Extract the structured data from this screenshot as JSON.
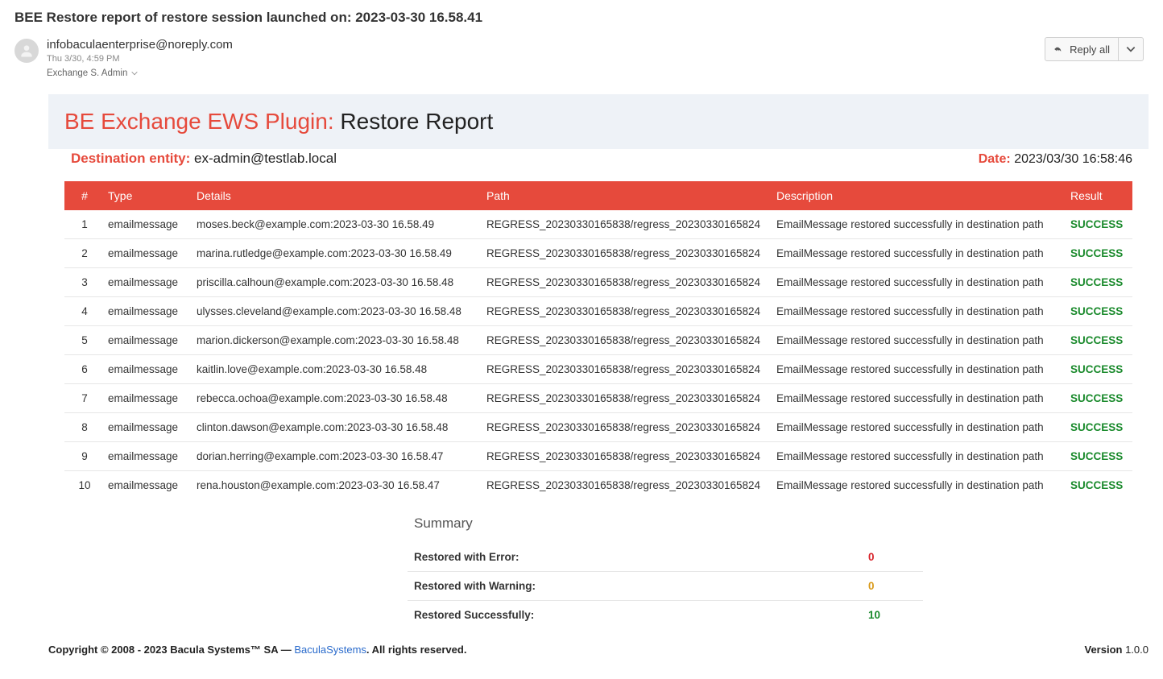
{
  "mail": {
    "subject": "BEE Restore report of restore session launched on: 2023-03-30 16.58.41",
    "sender_email": "infobaculaenterprise@noreply.com",
    "sent_time": "Thu 3/30, 4:59 PM",
    "recipient": "Exchange S. Admin",
    "reply_label": "Reply all"
  },
  "report": {
    "title_prefix": "BE Exchange EWS Plugin:",
    "title_main": "Restore Report",
    "dest_label": "Destination entity:",
    "dest_value": "ex-admin@testlab.local",
    "date_label": "Date:",
    "date_value": "2023/03/30 16:58:46"
  },
  "table": {
    "headers": {
      "num": "#",
      "type": "Type",
      "details": "Details",
      "path": "Path",
      "description": "Description",
      "result": "Result"
    },
    "rows": [
      {
        "num": "1",
        "type": "emailmessage",
        "details": "moses.beck@example.com:2023-03-30 16.58.49",
        "path": "REGRESS_20230330165838/regress_20230330165824",
        "description": "EmailMessage restored successfully in destination path",
        "result": "SUCCESS"
      },
      {
        "num": "2",
        "type": "emailmessage",
        "details": "marina.rutledge@example.com:2023-03-30 16.58.49",
        "path": "REGRESS_20230330165838/regress_20230330165824",
        "description": "EmailMessage restored successfully in destination path",
        "result": "SUCCESS"
      },
      {
        "num": "3",
        "type": "emailmessage",
        "details": "priscilla.calhoun@example.com:2023-03-30 16.58.48",
        "path": "REGRESS_20230330165838/regress_20230330165824",
        "description": "EmailMessage restored successfully in destination path",
        "result": "SUCCESS"
      },
      {
        "num": "4",
        "type": "emailmessage",
        "details": "ulysses.cleveland@example.com:2023-03-30 16.58.48",
        "path": "REGRESS_20230330165838/regress_20230330165824",
        "description": "EmailMessage restored successfully in destination path",
        "result": "SUCCESS"
      },
      {
        "num": "5",
        "type": "emailmessage",
        "details": "marion.dickerson@example.com:2023-03-30 16.58.48",
        "path": "REGRESS_20230330165838/regress_20230330165824",
        "description": "EmailMessage restored successfully in destination path",
        "result": "SUCCESS"
      },
      {
        "num": "6",
        "type": "emailmessage",
        "details": "kaitlin.love@example.com:2023-03-30 16.58.48",
        "path": "REGRESS_20230330165838/regress_20230330165824",
        "description": "EmailMessage restored successfully in destination path",
        "result": "SUCCESS"
      },
      {
        "num": "7",
        "type": "emailmessage",
        "details": "rebecca.ochoa@example.com:2023-03-30 16.58.48",
        "path": "REGRESS_20230330165838/regress_20230330165824",
        "description": "EmailMessage restored successfully in destination path",
        "result": "SUCCESS"
      },
      {
        "num": "8",
        "type": "emailmessage",
        "details": "clinton.dawson@example.com:2023-03-30 16.58.48",
        "path": "REGRESS_20230330165838/regress_20230330165824",
        "description": "EmailMessage restored successfully in destination path",
        "result": "SUCCESS"
      },
      {
        "num": "9",
        "type": "emailmessage",
        "details": "dorian.herring@example.com:2023-03-30 16.58.47",
        "path": "REGRESS_20230330165838/regress_20230330165824",
        "description": "EmailMessage restored successfully in destination path",
        "result": "SUCCESS"
      },
      {
        "num": "10",
        "type": "emailmessage",
        "details": "rena.houston@example.com:2023-03-30 16.58.47",
        "path": "REGRESS_20230330165838/regress_20230330165824",
        "description": "EmailMessage restored successfully in destination path",
        "result": "SUCCESS"
      }
    ]
  },
  "summary": {
    "title": "Summary",
    "rows": [
      {
        "label": "Restored with Error:",
        "value": "0",
        "kind": "error"
      },
      {
        "label": "Restored with Warning:",
        "value": "0",
        "kind": "warning"
      },
      {
        "label": "Restored Successfully:",
        "value": "10",
        "kind": "ok"
      }
    ]
  },
  "footer": {
    "copyright_prefix": "Copyright © 2008 - 2023 Bacula Systems™ SA — ",
    "link_text": "BaculaSystems",
    "copyright_suffix": ". All rights reserved.",
    "version_label": "Version",
    "version_value": " 1.0.0"
  }
}
